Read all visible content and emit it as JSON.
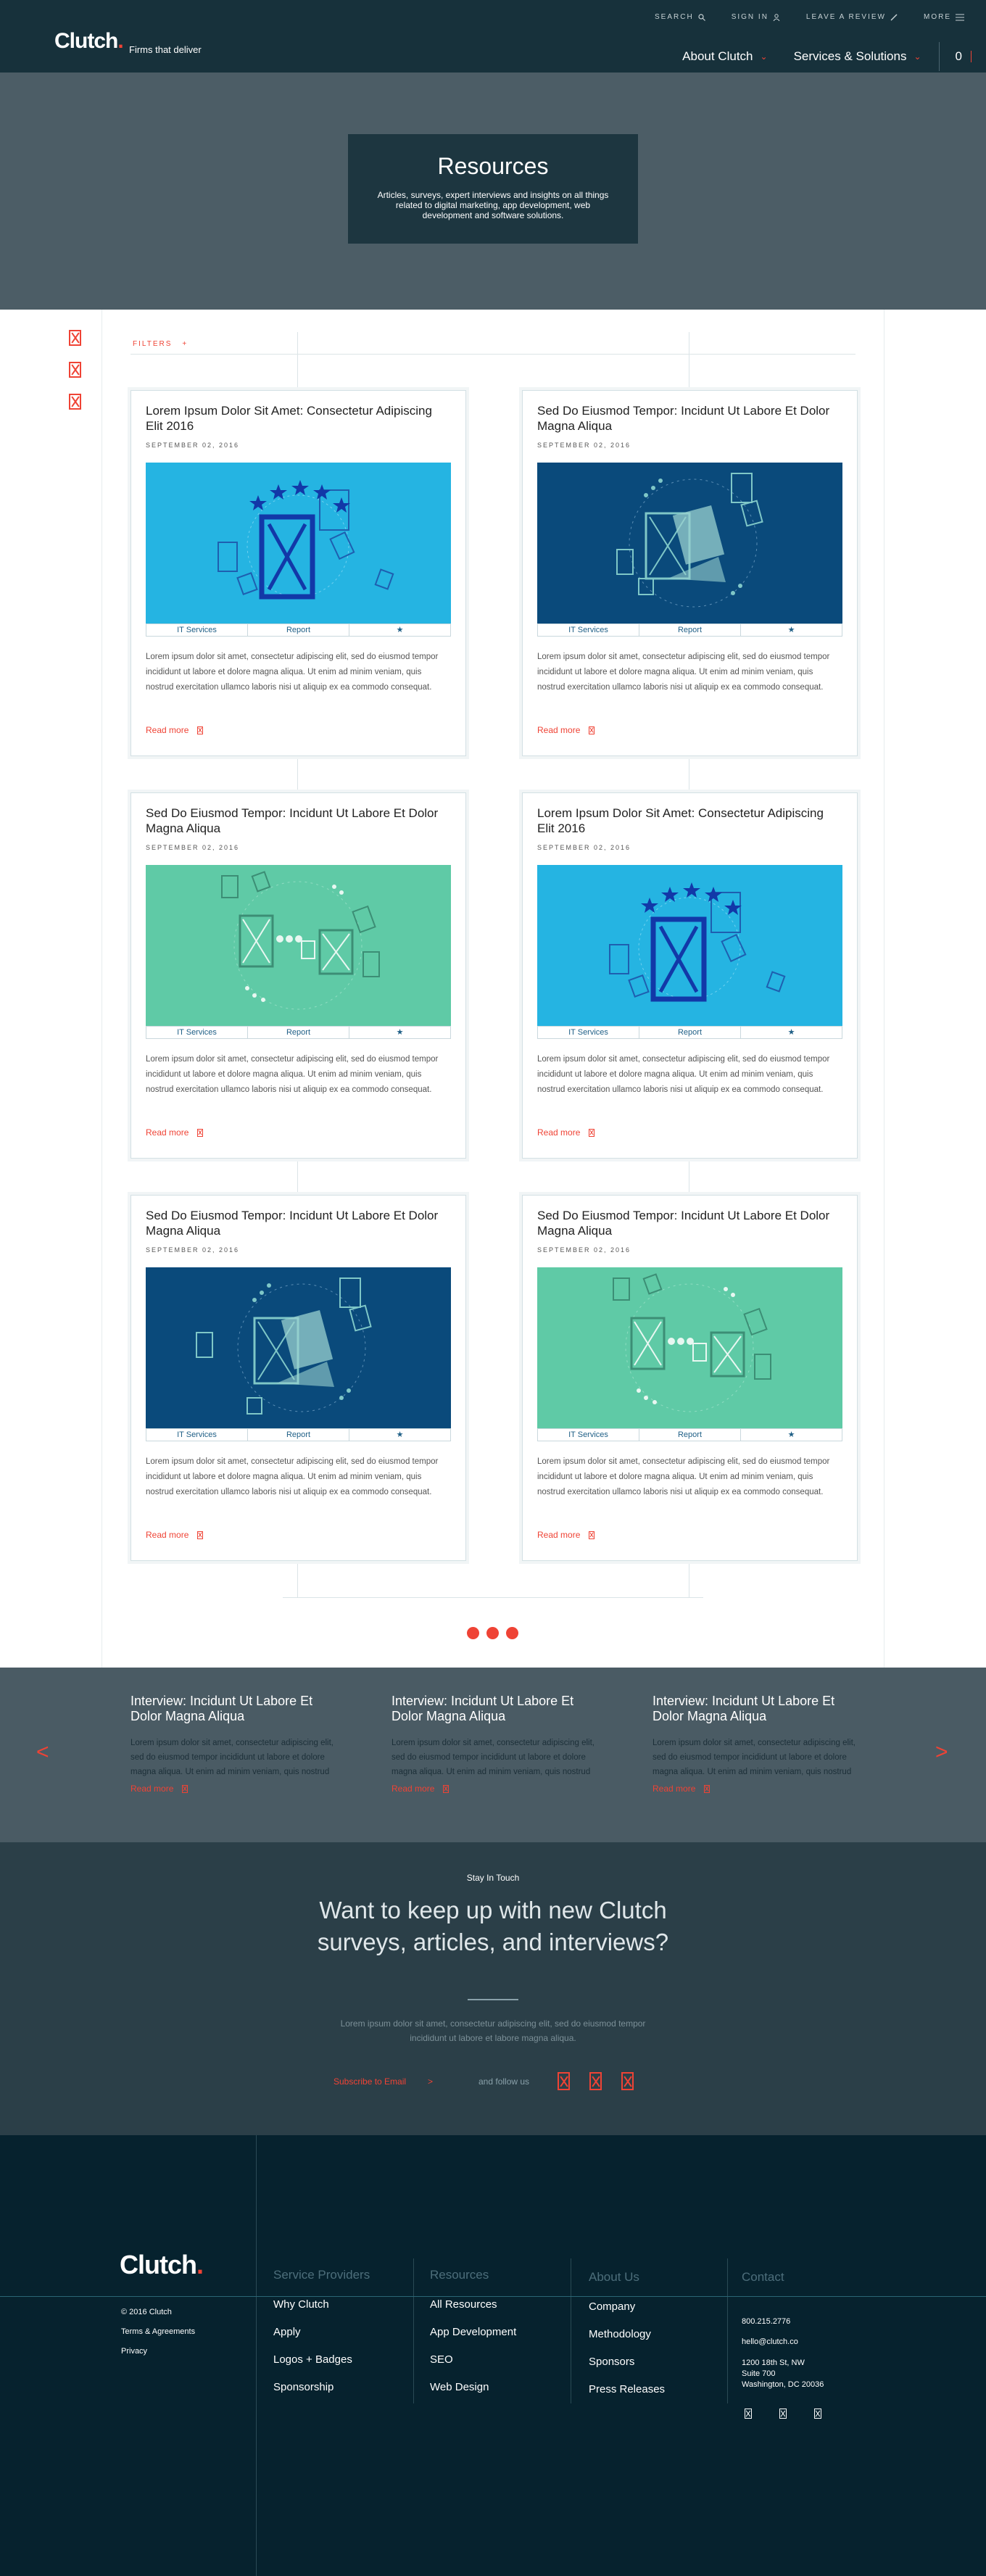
{
  "header": {
    "logo": "Clutch",
    "logo_dot": ".",
    "tagline": "Firms that deliver",
    "top_links": [
      {
        "label": "SEARCH",
        "icon": "search-icon"
      },
      {
        "label": "SIGN IN",
        "icon": "user-icon"
      },
      {
        "label": "LEAVE A REVIEW",
        "icon": "pencil-icon"
      },
      {
        "label": "MORE",
        "icon": "menu-icon"
      }
    ],
    "nav": [
      {
        "label": "About Clutch"
      },
      {
        "label": "Services & Solutions"
      }
    ],
    "cart_count": "0"
  },
  "hero": {
    "title": "Resources",
    "description": "Articles, surveys, expert interviews and insights on all things related to digital marketing, app development, web development and software solutions."
  },
  "filters": {
    "label": "FILTERS",
    "icon": "+"
  },
  "cards": [
    {
      "title": "Lorem Ipsum Dolor Sit Amet: Consectetur Adipiscing Elit 2016",
      "date": "SEPTEMBER 02, 2016",
      "tags": [
        "IT Services",
        "Report",
        "★"
      ],
      "body": "Lorem ipsum dolor sit amet, consectetur adipiscing elit, sed do eiusmod tempor incididunt ut labore et dolore magna aliqua. Ut enim ad minim veniam, quis nostrud exercitation ullamco laboris nisi ut aliquip ex ea commodo consequat.",
      "read_more": "Read more"
    },
    {
      "title": "Sed Do Eiusmod Tempor: Incidunt Ut Labore Et Dolor Magna Aliqua",
      "date": "SEPTEMBER 02, 2016",
      "tags": [
        "IT Services",
        "Report",
        "★"
      ],
      "body": "Lorem ipsum dolor sit amet, consectetur adipiscing elit, sed do eiusmod tempor incididunt ut labore et dolore magna aliqua. Ut enim ad minim veniam, quis nostrud exercitation ullamco laboris nisi ut aliquip ex ea commodo consequat.",
      "read_more": "Read more"
    },
    {
      "title": "Sed Do Eiusmod Tempor: Incidunt Ut Labore Et Dolor Magna Aliqua",
      "date": "SEPTEMBER 02, 2016",
      "tags": [
        "IT Services",
        "Report",
        "★"
      ],
      "body": "Lorem ipsum dolor sit amet, consectetur adipiscing elit, sed do eiusmod tempor incididunt ut labore et dolore magna aliqua. Ut enim ad minim veniam, quis nostrud exercitation ullamco laboris nisi ut aliquip ex ea commodo consequat.",
      "read_more": "Read more"
    },
    {
      "title": "Lorem Ipsum Dolor Sit Amet: Consectetur Adipiscing Elit 2016",
      "date": "SEPTEMBER 02, 2016",
      "tags": [
        "IT Services",
        "Report",
        "★"
      ],
      "body": "Lorem ipsum dolor sit amet, consectetur adipiscing elit, sed do eiusmod tempor incididunt ut labore et dolore magna aliqua. Ut enim ad minim veniam, quis nostrud exercitation ullamco laboris nisi ut aliquip ex ea commodo consequat.",
      "read_more": "Read more"
    },
    {
      "title": "Sed Do Eiusmod Tempor: Incidunt Ut Labore Et Dolor Magna Aliqua",
      "date": "SEPTEMBER 02, 2016",
      "tags": [
        "IT Services",
        "Report",
        "★"
      ],
      "body": "Lorem ipsum dolor sit amet, consectetur adipiscing elit, sed do eiusmod tempor incididunt ut labore et dolore magna aliqua. Ut enim ad minim veniam, quis nostrud exercitation ullamco laboris nisi ut aliquip ex ea commodo consequat.",
      "read_more": "Read more"
    },
    {
      "title": "Sed Do Eiusmod Tempor: Incidunt Ut Labore Et Dolor Magna Aliqua",
      "date": "SEPTEMBER 02, 2016",
      "tags": [
        "IT Services",
        "Report",
        "★"
      ],
      "body": "Lorem ipsum dolor sit amet, consectetur adipiscing elit, sed do eiusmod tempor incididunt ut labore et dolore magna aliqua. Ut enim ad minim veniam, quis nostrud exercitation ullamco laboris nisi ut aliquip ex ea commodo consequat.",
      "read_more": "Read more"
    }
  ],
  "interviews": {
    "prev": "<",
    "next": ">",
    "items": [
      {
        "title": "Interview: Incidunt Ut Labore Et Dolor Magna Aliqua",
        "body": "Lorem ipsum dolor sit amet, consectetur adipiscing elit, sed do eiusmod tempor incididunt ut labore et dolore magna aliqua. Ut enim ad minim veniam, quis nostrud",
        "read_more": "Read more"
      },
      {
        "title": "Interview: Incidunt Ut Labore Et Dolor Magna Aliqua",
        "body": "Lorem ipsum dolor sit amet, consectetur adipiscing elit, sed do eiusmod tempor incididunt ut labore et dolore magna aliqua. Ut enim ad minim veniam, quis nostrud",
        "read_more": "Read more"
      },
      {
        "title": "Interview: Incidunt Ut Labore Et Dolor Magna Aliqua",
        "body": "Lorem ipsum dolor sit amet, consectetur adipiscing elit, sed do eiusmod tempor incididunt ut labore et dolore magna aliqua. Ut enim ad minim veniam, quis nostrud",
        "read_more": "Read more"
      }
    ]
  },
  "touch": {
    "label": "Stay In Touch",
    "title": "Want to keep up with new Clutch surveys, articles, and interviews?",
    "description": "Lorem ipsum dolor sit amet, consectetur adipiscing elit, sed do eiusmod tempor incididunt ut labore et labore magna aliqua.",
    "subscribe": "Subscribe to Email",
    "subscribe_arrow": ">",
    "follow": "and follow us"
  },
  "footer": {
    "logo": "Clutch",
    "logo_dot": ".",
    "copyright": "© 2016 Clutch",
    "terms": "Terms & Agreements",
    "privacy": "Privacy",
    "columns": [
      {
        "heading": "Service Providers",
        "links": [
          "Why Clutch",
          "Apply",
          "Logos + Badges",
          "Sponsorship"
        ]
      },
      {
        "heading": "Resources",
        "links": [
          "All Resources",
          "App Development",
          "SEO",
          "Web Design"
        ]
      },
      {
        "heading": "About Us",
        "links": [
          "Company",
          "Methodology",
          "Sponsors",
          "Press Releases"
        ]
      }
    ],
    "contact": {
      "heading": "Contact",
      "phone": "800.215.2776",
      "email": "hello@clutch.co",
      "address_line1": "1200 18th St, NW",
      "address_line2": "Suite 700",
      "address_line3": "Washington, DC 20036"
    }
  },
  "colors": {
    "accent": "#ef4335",
    "header_bg": "#17313b",
    "hero_bg": "#4c5d66",
    "footer_bg": "#06222e",
    "img_light_blue": "#25b4e2",
    "img_dark_blue": "#0a4a7b",
    "img_teal": "#5fcaa6"
  }
}
